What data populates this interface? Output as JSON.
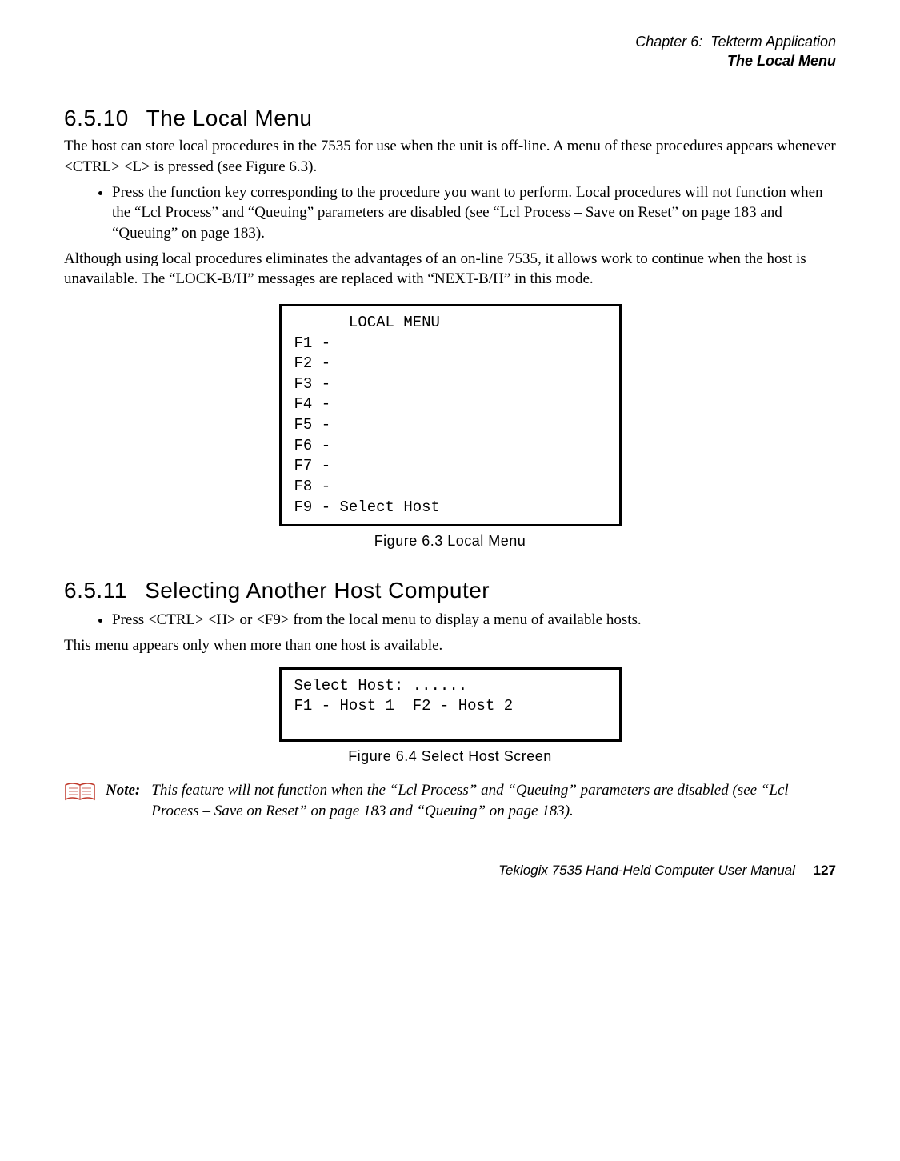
{
  "header": {
    "chapter": "Chapter 6:  Tekterm Application",
    "subtitle": "The Local Menu"
  },
  "s6510": {
    "num": "6.5.10",
    "title": "The Local Menu",
    "para1": "The host can store local procedures in the 7535 for use when the unit is off-line. A menu of these procedures appears whenever  <CTRL> <L> is pressed (see Figure 6.3).",
    "bullet1": "Press the function key corresponding to the procedure you want to perform. Local procedures will not function when the “Lcl Process” and “Queuing” parameters are disabled (see “Lcl Process – Save on Reset” on page 183 and “Queuing” on page 183).",
    "para2": "Although using local procedures eliminates the advantages of an on-line 7535, it allows work to continue when the host is unavailable. The “LOCK-B/H” messages are replaced with “NEXT-B/H” in this mode."
  },
  "fig63": {
    "title": "      LOCAL MENU",
    "lines": "F1 -\nF2 -\nF3 -\nF4 -\nF5 -\nF6 -\nF7 -\nF8 -\nF9 - Select Host",
    "caption": "Figure 6.3 Local Menu"
  },
  "s6511": {
    "num": "6.5.11",
    "title": "Selecting Another Host Computer",
    "bullet1": "Press  <CTRL> <H> or <F9> from the local menu to display a menu of available hosts.",
    "para1": "This menu appears only when more than one host is available."
  },
  "fig64": {
    "lines": "Select Host: ......\nF1 - Host 1  F2 - Host 2",
    "caption": "Figure 6.4 Select Host Screen"
  },
  "note": {
    "label": "Note:",
    "text": "This feature will not function when the “Lcl Process” and “Queuing” parameters are disabled (see “Lcl Process – Save on Reset” on page 183 and “Queuing” on page 183)."
  },
  "footer": {
    "manual": "Teklogix 7535 Hand-Held Computer User Manual",
    "page": "127"
  }
}
